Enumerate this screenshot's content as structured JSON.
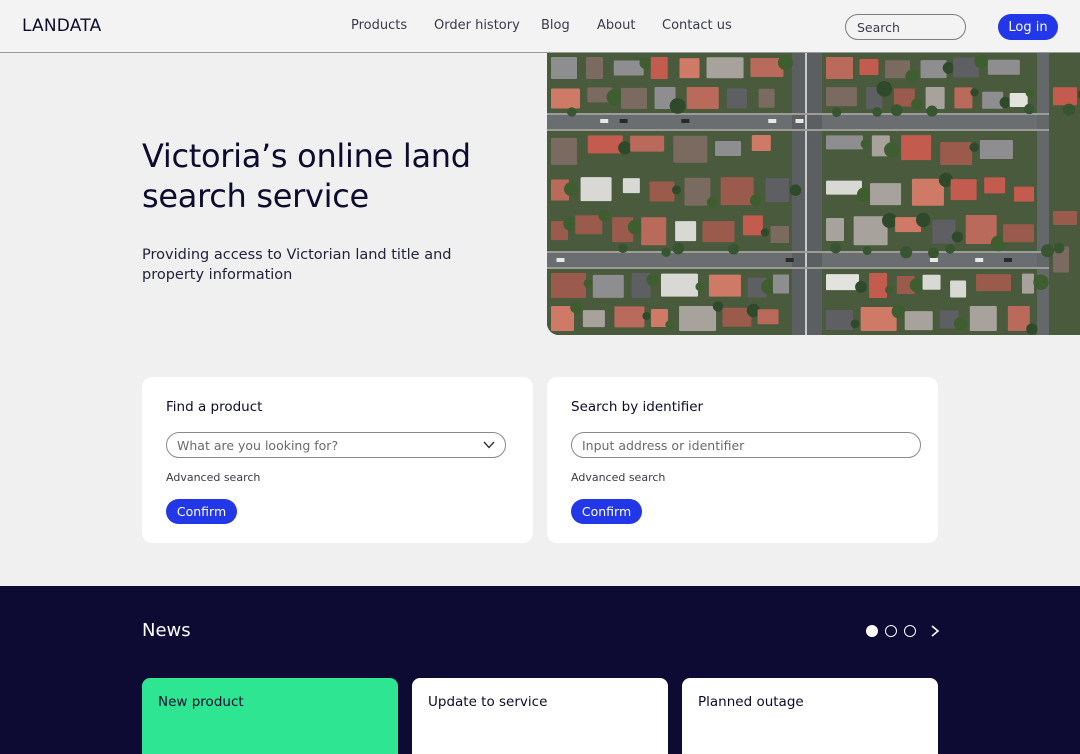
{
  "header": {
    "logo": "LANDATA",
    "nav": [
      {
        "label": "Products"
      },
      {
        "label": "Order history"
      },
      {
        "label": "Blog"
      },
      {
        "label": "About"
      },
      {
        "label": "Contact us"
      }
    ],
    "search_placeholder": "Search",
    "login_label": "Log in"
  },
  "hero": {
    "title": "Victoria’s online land search service",
    "subtitle": "Providing access to Victorian land title and property information",
    "image_icon": "aerial-suburb-image"
  },
  "find_product": {
    "title": "Find a product",
    "placeholder": "What are you looking for?",
    "advanced_label": "Advanced search",
    "confirm_label": "Confirm"
  },
  "search_identifier": {
    "title": "Search by identifier",
    "placeholder": "Input address or identifier",
    "advanced_label": "Advanced search",
    "confirm_label": "Confirm"
  },
  "news": {
    "title": "News",
    "carousel": {
      "pages": 3,
      "active_index": 0
    },
    "cards": [
      {
        "label": "New product",
        "highlight": true
      },
      {
        "label": "Update to service",
        "highlight": false
      },
      {
        "label": "Planned outage",
        "highlight": false
      }
    ]
  },
  "colors": {
    "primary": "#2237e8",
    "news_background": "#0d0a33",
    "highlight_card": "#2ee592",
    "page_background": "#f0f0f0"
  }
}
